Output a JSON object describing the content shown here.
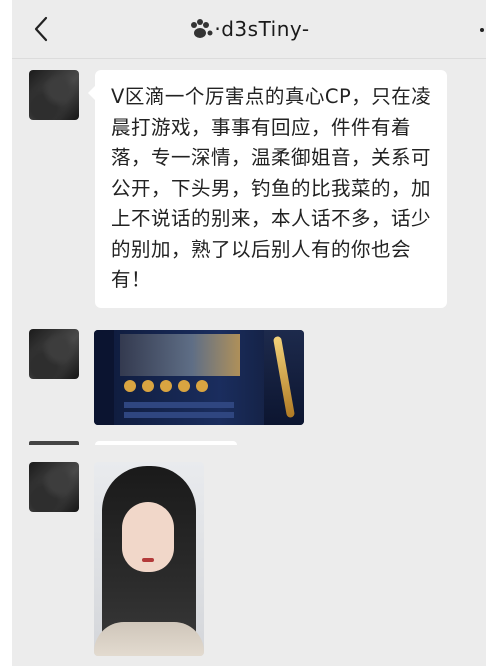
{
  "header": {
    "title": "·d3sTiny-",
    "back_icon": "chevron-left-icon",
    "title_icon": "paw-icon"
  },
  "messages": [
    {
      "type": "text",
      "text": "V区滴一个厉害点的真心CP，只在凌晨打游戏，事事有回应，件件有着落，专一深情，温柔御姐音，关系可公开，下头男，钓鱼的比我菜的，加上不说话的别来，本人话不多，话少的别加，熟了以后别人有的你也会有！"
    },
    {
      "type": "image",
      "content": "game-screenshot"
    },
    {
      "type": "image",
      "content": "selfie-photo"
    }
  ],
  "colors": {
    "background": "#ececec",
    "bubble": "#ffffff",
    "text": "#222222"
  }
}
